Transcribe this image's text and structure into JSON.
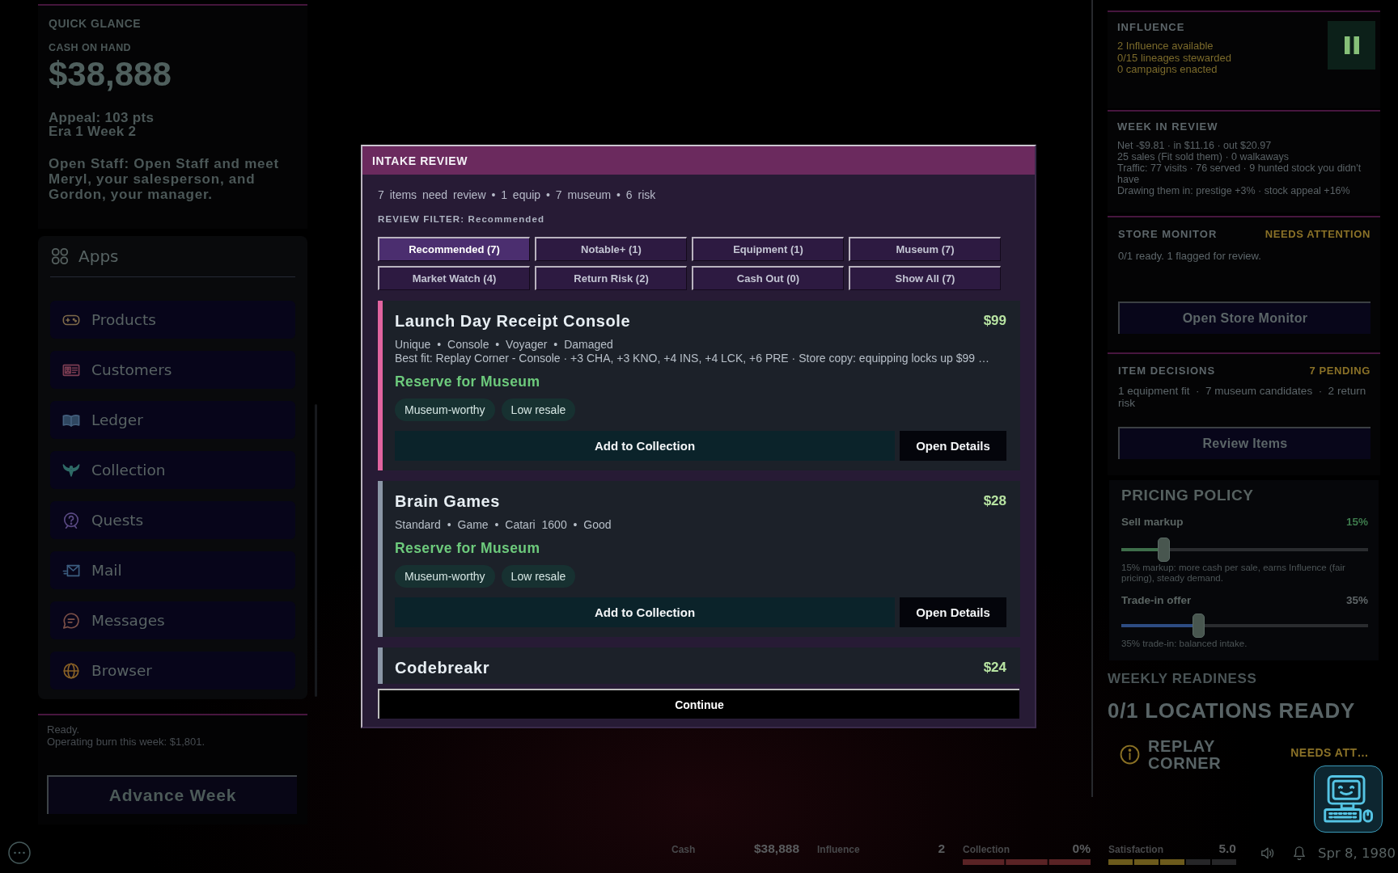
{
  "quick_glance": {
    "title": "QUICK GLANCE",
    "cash_label": "CASH ON HAND",
    "cash": "$38,888",
    "stats": [
      "Appeal: 103 pts",
      "Era 1 Week 2"
    ],
    "objective": "Open Staff: Open Staff and meet Meryl, your salesperson, and Gordon, your manager."
  },
  "apps": {
    "title": "Apps",
    "items": [
      {
        "label": "Products"
      },
      {
        "label": "Customers"
      },
      {
        "label": "Ledger"
      },
      {
        "label": "Collection"
      },
      {
        "label": "Quests"
      },
      {
        "label": "Mail"
      },
      {
        "label": "Messages"
      },
      {
        "label": "Browser"
      }
    ]
  },
  "status": {
    "lines": [
      "Ready.",
      "Operating burn this week: $1,801."
    ]
  },
  "advance_button": "Advance Week",
  "modal": {
    "title": "INTAKE REVIEW",
    "summary": "7 items need review • 1 equip • 7 museum • 6 risk",
    "filter_label": "REVIEW FILTER: Recommended",
    "filters": [
      {
        "label": "Recommended (7)",
        "selected": true
      },
      {
        "label": "Notable+ (1)",
        "selected": false
      },
      {
        "label": "Equipment (1)",
        "selected": false
      },
      {
        "label": "Museum (7)",
        "selected": false
      },
      {
        "label": "Market Watch (4)",
        "selected": false
      },
      {
        "label": "Return Risk (2)",
        "selected": false
      },
      {
        "label": "Cash Out (0)",
        "selected": false
      },
      {
        "label": "Show All (7)",
        "selected": false
      }
    ],
    "items": [
      {
        "title": "Launch Day Receipt Console",
        "price": "$99",
        "color": "#e2649f",
        "meta": "Unique • Console • Voyager • Damaged",
        "best_fit": "Best fit: Replay Corner - Console · +3 CHA, +3 KNO, +4 INS, +4 LCK, +6 PRE · Store copy: equipping locks up $99 …",
        "recommendation": "Reserve for Museum",
        "tags": [
          "Museum-worthy",
          "Low resale"
        ],
        "actions": [
          "Add to Collection",
          "Open Details"
        ]
      },
      {
        "title": "Brain Games",
        "price": "$28",
        "color": "#8a96a6",
        "meta": "Standard • Game • Catari 1600 • Good",
        "recommendation": "Reserve for Museum",
        "tags": [
          "Museum-worthy",
          "Low resale"
        ],
        "actions": [
          "Add to Collection",
          "Open Details"
        ]
      },
      {
        "title": "Codebreakr",
        "price": "$24",
        "color": "#8a96a6"
      }
    ],
    "continue_button": "Continue"
  },
  "right_panel": {
    "influence": {
      "title": "INFLUENCE",
      "lines": [
        "2 Influence available",
        "0/15 lineages stewarded",
        "0 campaigns enacted"
      ]
    },
    "week_in_review": {
      "title": "WEEK IN REVIEW",
      "lines": [
        "Net -$9.81 · in $11.16 · out $20.97",
        "25 sales (Fit sold them) · 0 walkaways",
        "Traffic: 77 visits · 76 served · 9 hunted stock you didn't have",
        "Drawing them in: prestige +3% · stock appeal +16%"
      ]
    },
    "store_monitor": {
      "title": "STORE MONITOR",
      "status": "NEEDS ATTENTION",
      "text": "0/1 ready. 1 flagged for review.",
      "button": "Open Store Monitor"
    },
    "item_decisions": {
      "title": "ITEM DECISIONS",
      "status": "7 PENDING",
      "text": "1 equipment fit  ·  7 museum candidates  ·  2 return risk",
      "button": "Review Items"
    },
    "pricing_policy": {
      "title": "PRICING POLICY",
      "sliders": [
        {
          "label": "Sell markup",
          "reading": "15%",
          "highlighted": true,
          "level": 0.17,
          "color": "#3e6e4b",
          "caption": "15% markup: more cash per sale, earns Influence (fair pricing), steady demand."
        },
        {
          "label": "Trade-in offer",
          "reading": "35%",
          "highlighted": false,
          "level": 0.31,
          "color": "#2d4c82",
          "caption": "35% trade-in: balanced intake."
        }
      ]
    },
    "weekly_readiness": {
      "title": "WEEKLY READINESS",
      "headline": "0/1 LOCATIONS READY",
      "locations": [
        {
          "name": "REPLAY CORNER",
          "status": "NEEDS ATT…"
        }
      ]
    }
  },
  "bottom_bar": {
    "stats": [
      {
        "kind": "value",
        "label": "Cash",
        "value": "$38,888"
      },
      {
        "kind": "value",
        "label": "Influence",
        "value": "2"
      },
      {
        "kind": "progress",
        "label": "Collection",
        "value": "0%",
        "warning": true
      },
      {
        "kind": "rating",
        "label": "Satisfaction",
        "value": "5.0",
        "level": 0.6,
        "warning": false
      }
    ],
    "date": "Spr 8, 1980"
  }
}
